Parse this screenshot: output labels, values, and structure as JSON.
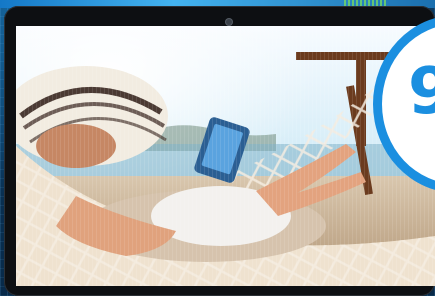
{
  "scene": {
    "description_icon": "photo",
    "badge_icon": "brand-circle-icon",
    "colors": {
      "accent": "#1b8fe0",
      "frame": "#0d0f12",
      "circuit": "#0b3b63"
    }
  }
}
